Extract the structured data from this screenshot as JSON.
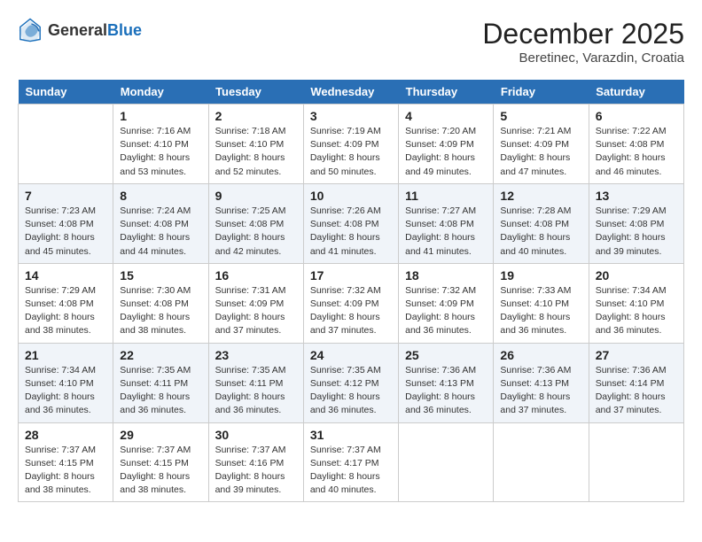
{
  "logo": {
    "general": "General",
    "blue": "Blue"
  },
  "title": "December 2025",
  "location": "Beretinec, Varazdin, Croatia",
  "days_of_week": [
    "Sunday",
    "Monday",
    "Tuesday",
    "Wednesday",
    "Thursday",
    "Friday",
    "Saturday"
  ],
  "weeks": [
    [
      {
        "date": "",
        "info": ""
      },
      {
        "date": "1",
        "info": "Sunrise: 7:16 AM\nSunset: 4:10 PM\nDaylight: 8 hours\nand 53 minutes."
      },
      {
        "date": "2",
        "info": "Sunrise: 7:18 AM\nSunset: 4:10 PM\nDaylight: 8 hours\nand 52 minutes."
      },
      {
        "date": "3",
        "info": "Sunrise: 7:19 AM\nSunset: 4:09 PM\nDaylight: 8 hours\nand 50 minutes."
      },
      {
        "date": "4",
        "info": "Sunrise: 7:20 AM\nSunset: 4:09 PM\nDaylight: 8 hours\nand 49 minutes."
      },
      {
        "date": "5",
        "info": "Sunrise: 7:21 AM\nSunset: 4:09 PM\nDaylight: 8 hours\nand 47 minutes."
      },
      {
        "date": "6",
        "info": "Sunrise: 7:22 AM\nSunset: 4:08 PM\nDaylight: 8 hours\nand 46 minutes."
      }
    ],
    [
      {
        "date": "7",
        "info": "Sunrise: 7:23 AM\nSunset: 4:08 PM\nDaylight: 8 hours\nand 45 minutes."
      },
      {
        "date": "8",
        "info": "Sunrise: 7:24 AM\nSunset: 4:08 PM\nDaylight: 8 hours\nand 44 minutes."
      },
      {
        "date": "9",
        "info": "Sunrise: 7:25 AM\nSunset: 4:08 PM\nDaylight: 8 hours\nand 42 minutes."
      },
      {
        "date": "10",
        "info": "Sunrise: 7:26 AM\nSunset: 4:08 PM\nDaylight: 8 hours\nand 41 minutes."
      },
      {
        "date": "11",
        "info": "Sunrise: 7:27 AM\nSunset: 4:08 PM\nDaylight: 8 hours\nand 41 minutes."
      },
      {
        "date": "12",
        "info": "Sunrise: 7:28 AM\nSunset: 4:08 PM\nDaylight: 8 hours\nand 40 minutes."
      },
      {
        "date": "13",
        "info": "Sunrise: 7:29 AM\nSunset: 4:08 PM\nDaylight: 8 hours\nand 39 minutes."
      }
    ],
    [
      {
        "date": "14",
        "info": "Sunrise: 7:29 AM\nSunset: 4:08 PM\nDaylight: 8 hours\nand 38 minutes."
      },
      {
        "date": "15",
        "info": "Sunrise: 7:30 AM\nSunset: 4:08 PM\nDaylight: 8 hours\nand 38 minutes."
      },
      {
        "date": "16",
        "info": "Sunrise: 7:31 AM\nSunset: 4:09 PM\nDaylight: 8 hours\nand 37 minutes."
      },
      {
        "date": "17",
        "info": "Sunrise: 7:32 AM\nSunset: 4:09 PM\nDaylight: 8 hours\nand 37 minutes."
      },
      {
        "date": "18",
        "info": "Sunrise: 7:32 AM\nSunset: 4:09 PM\nDaylight: 8 hours\nand 36 minutes."
      },
      {
        "date": "19",
        "info": "Sunrise: 7:33 AM\nSunset: 4:10 PM\nDaylight: 8 hours\nand 36 minutes."
      },
      {
        "date": "20",
        "info": "Sunrise: 7:34 AM\nSunset: 4:10 PM\nDaylight: 8 hours\nand 36 minutes."
      }
    ],
    [
      {
        "date": "21",
        "info": "Sunrise: 7:34 AM\nSunset: 4:10 PM\nDaylight: 8 hours\nand 36 minutes."
      },
      {
        "date": "22",
        "info": "Sunrise: 7:35 AM\nSunset: 4:11 PM\nDaylight: 8 hours\nand 36 minutes."
      },
      {
        "date": "23",
        "info": "Sunrise: 7:35 AM\nSunset: 4:11 PM\nDaylight: 8 hours\nand 36 minutes."
      },
      {
        "date": "24",
        "info": "Sunrise: 7:35 AM\nSunset: 4:12 PM\nDaylight: 8 hours\nand 36 minutes."
      },
      {
        "date": "25",
        "info": "Sunrise: 7:36 AM\nSunset: 4:13 PM\nDaylight: 8 hours\nand 36 minutes."
      },
      {
        "date": "26",
        "info": "Sunrise: 7:36 AM\nSunset: 4:13 PM\nDaylight: 8 hours\nand 37 minutes."
      },
      {
        "date": "27",
        "info": "Sunrise: 7:36 AM\nSunset: 4:14 PM\nDaylight: 8 hours\nand 37 minutes."
      }
    ],
    [
      {
        "date": "28",
        "info": "Sunrise: 7:37 AM\nSunset: 4:15 PM\nDaylight: 8 hours\nand 38 minutes."
      },
      {
        "date": "29",
        "info": "Sunrise: 7:37 AM\nSunset: 4:15 PM\nDaylight: 8 hours\nand 38 minutes."
      },
      {
        "date": "30",
        "info": "Sunrise: 7:37 AM\nSunset: 4:16 PM\nDaylight: 8 hours\nand 39 minutes."
      },
      {
        "date": "31",
        "info": "Sunrise: 7:37 AM\nSunset: 4:17 PM\nDaylight: 8 hours\nand 40 minutes."
      },
      {
        "date": "",
        "info": ""
      },
      {
        "date": "",
        "info": ""
      },
      {
        "date": "",
        "info": ""
      }
    ]
  ]
}
